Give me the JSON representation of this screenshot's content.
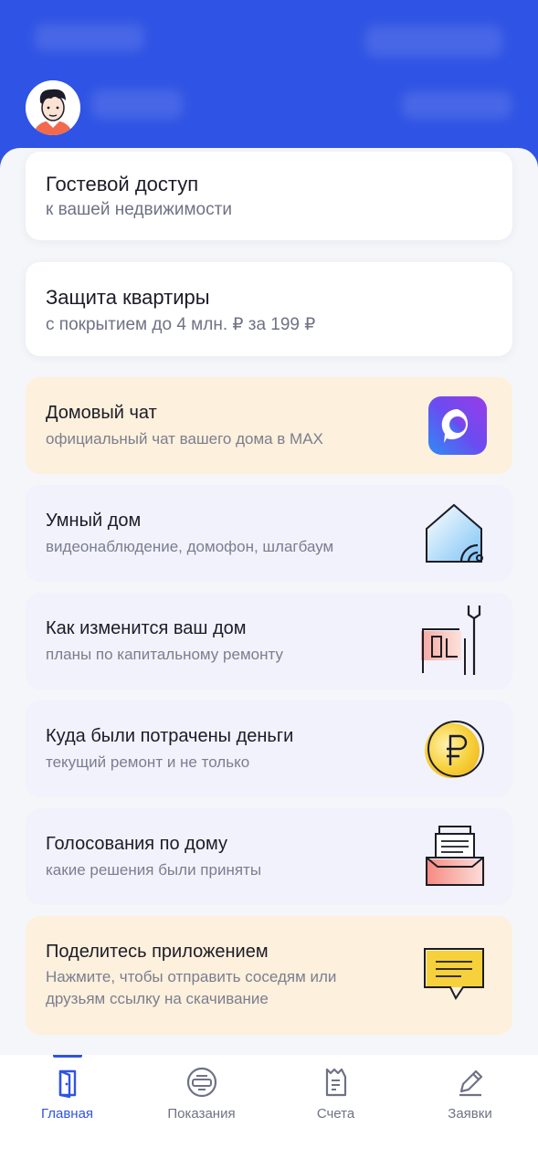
{
  "app": {
    "accent_color": "#2f53e4",
    "header_color": "#2f53e4"
  },
  "header": {
    "avatar_icon": "user-avatar-illustration"
  },
  "cards": [
    {
      "title": "Гостевой доступ",
      "subtitle": "к вашей недвижимости",
      "style": "white"
    },
    {
      "title": "Защита квартиры",
      "subtitle": "с покрытием до 4 млн. ₽ за 199 ₽",
      "style": "white"
    },
    {
      "title": "Домовый чат",
      "subtitle": "официальный чат вашего дома в MAX",
      "style": "peach",
      "icon": "max-messenger-icon"
    },
    {
      "title": "Умный дом",
      "subtitle": "видеонаблюдение, домофон, шлагбаум",
      "style": "lavender",
      "icon": "smart-home-icon"
    },
    {
      "title": "Как изменится ваш дом",
      "subtitle": "планы по капитальному ремонту",
      "style": "lavender",
      "icon": "renovation-icon"
    },
    {
      "title": "Куда были потрачены деньги",
      "subtitle": "текущий ремонт и не только",
      "style": "lavender",
      "icon": "ruble-coin-icon"
    },
    {
      "title": "Голосования по дому",
      "subtitle": "какие решения были приняты",
      "style": "lavender",
      "icon": "ballot-box-icon"
    },
    {
      "title": "Поделитесь приложением",
      "subtitle_line1": "Нажмите, чтобы отправить соседям или",
      "subtitle_line2": "друзьям ссылку на скачивание",
      "style": "peach",
      "icon": "message-icon"
    }
  ],
  "tabbar": {
    "tabs": [
      {
        "label": "Главная",
        "icon": "door-icon",
        "active": true
      },
      {
        "label": "Показания",
        "icon": "meter-icon",
        "active": false
      },
      {
        "label": "Счета",
        "icon": "receipt-icon",
        "active": false
      },
      {
        "label": "Заявки",
        "icon": "pencil-icon",
        "active": false
      }
    ]
  }
}
